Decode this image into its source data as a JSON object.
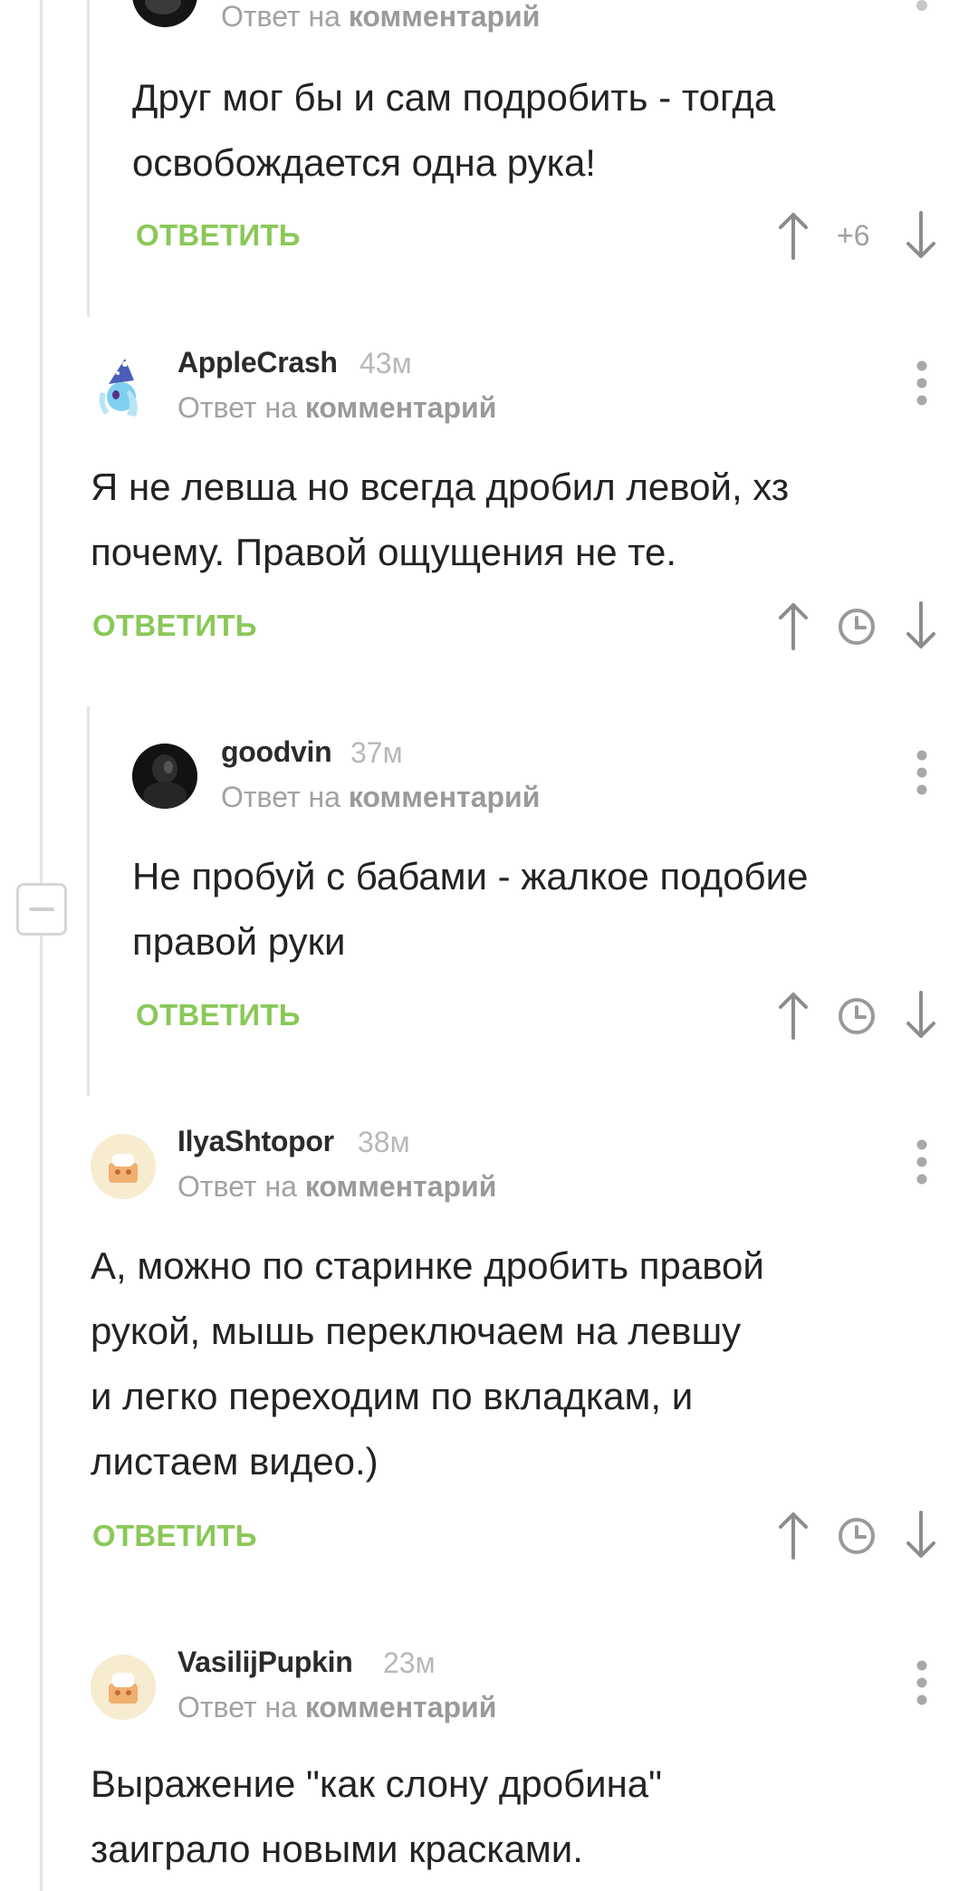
{
  "comments": [
    {
      "text": "Друг мог бы и сам подробить - тогда\nосвобождается одна рука!",
      "reply_label": "Ответ на",
      "reply_target": "комментарий",
      "reply_button": "ОТВЕТИТЬ",
      "score": "+6"
    },
    {
      "username": "AppleCrash",
      "time": "43м",
      "reply_label": "Ответ на",
      "reply_target": "комментарий",
      "text": "Я не левша но всегда дробил левой, хз\nпочему. Правой ощущения не те.",
      "reply_button": "ОТВЕТИТЬ"
    },
    {
      "username": "goodvin",
      "time": "37м",
      "reply_label": "Ответ на",
      "reply_target": "комментарий",
      "text": "Не пробуй с бабами - жалкое подобие\nправой руки",
      "reply_button": "ОТВЕТИТЬ"
    },
    {
      "username": "IlyaShtopor",
      "time": "38м",
      "reply_label": "Ответ на",
      "reply_target": "комментарий",
      "text": "А, можно по старинке  дробить правой\nрукой, мышь переключаем на левшу\nи легко переходим по вкладкам, и\nлистаем видео.)",
      "reply_button": "ОТВЕТИТЬ"
    },
    {
      "username": "VasilijPupkin",
      "time": "23м",
      "reply_label": "Ответ на",
      "reply_target": "комментарий",
      "text": "Выражение \"как слону дробина\"\nзаиграло новыми красками."
    }
  ],
  "colors": {
    "accent_green": "#8ac858",
    "text": "#232323",
    "muted": "#a2a2a2",
    "thread_line": "#e4e4e4"
  },
  "icons": {
    "upvote": "arrow-up-icon",
    "downvote": "arrow-down-icon",
    "pending_score": "clock-icon",
    "more": "kebab-menu-icon",
    "collapse": "collapse-minus-icon"
  }
}
